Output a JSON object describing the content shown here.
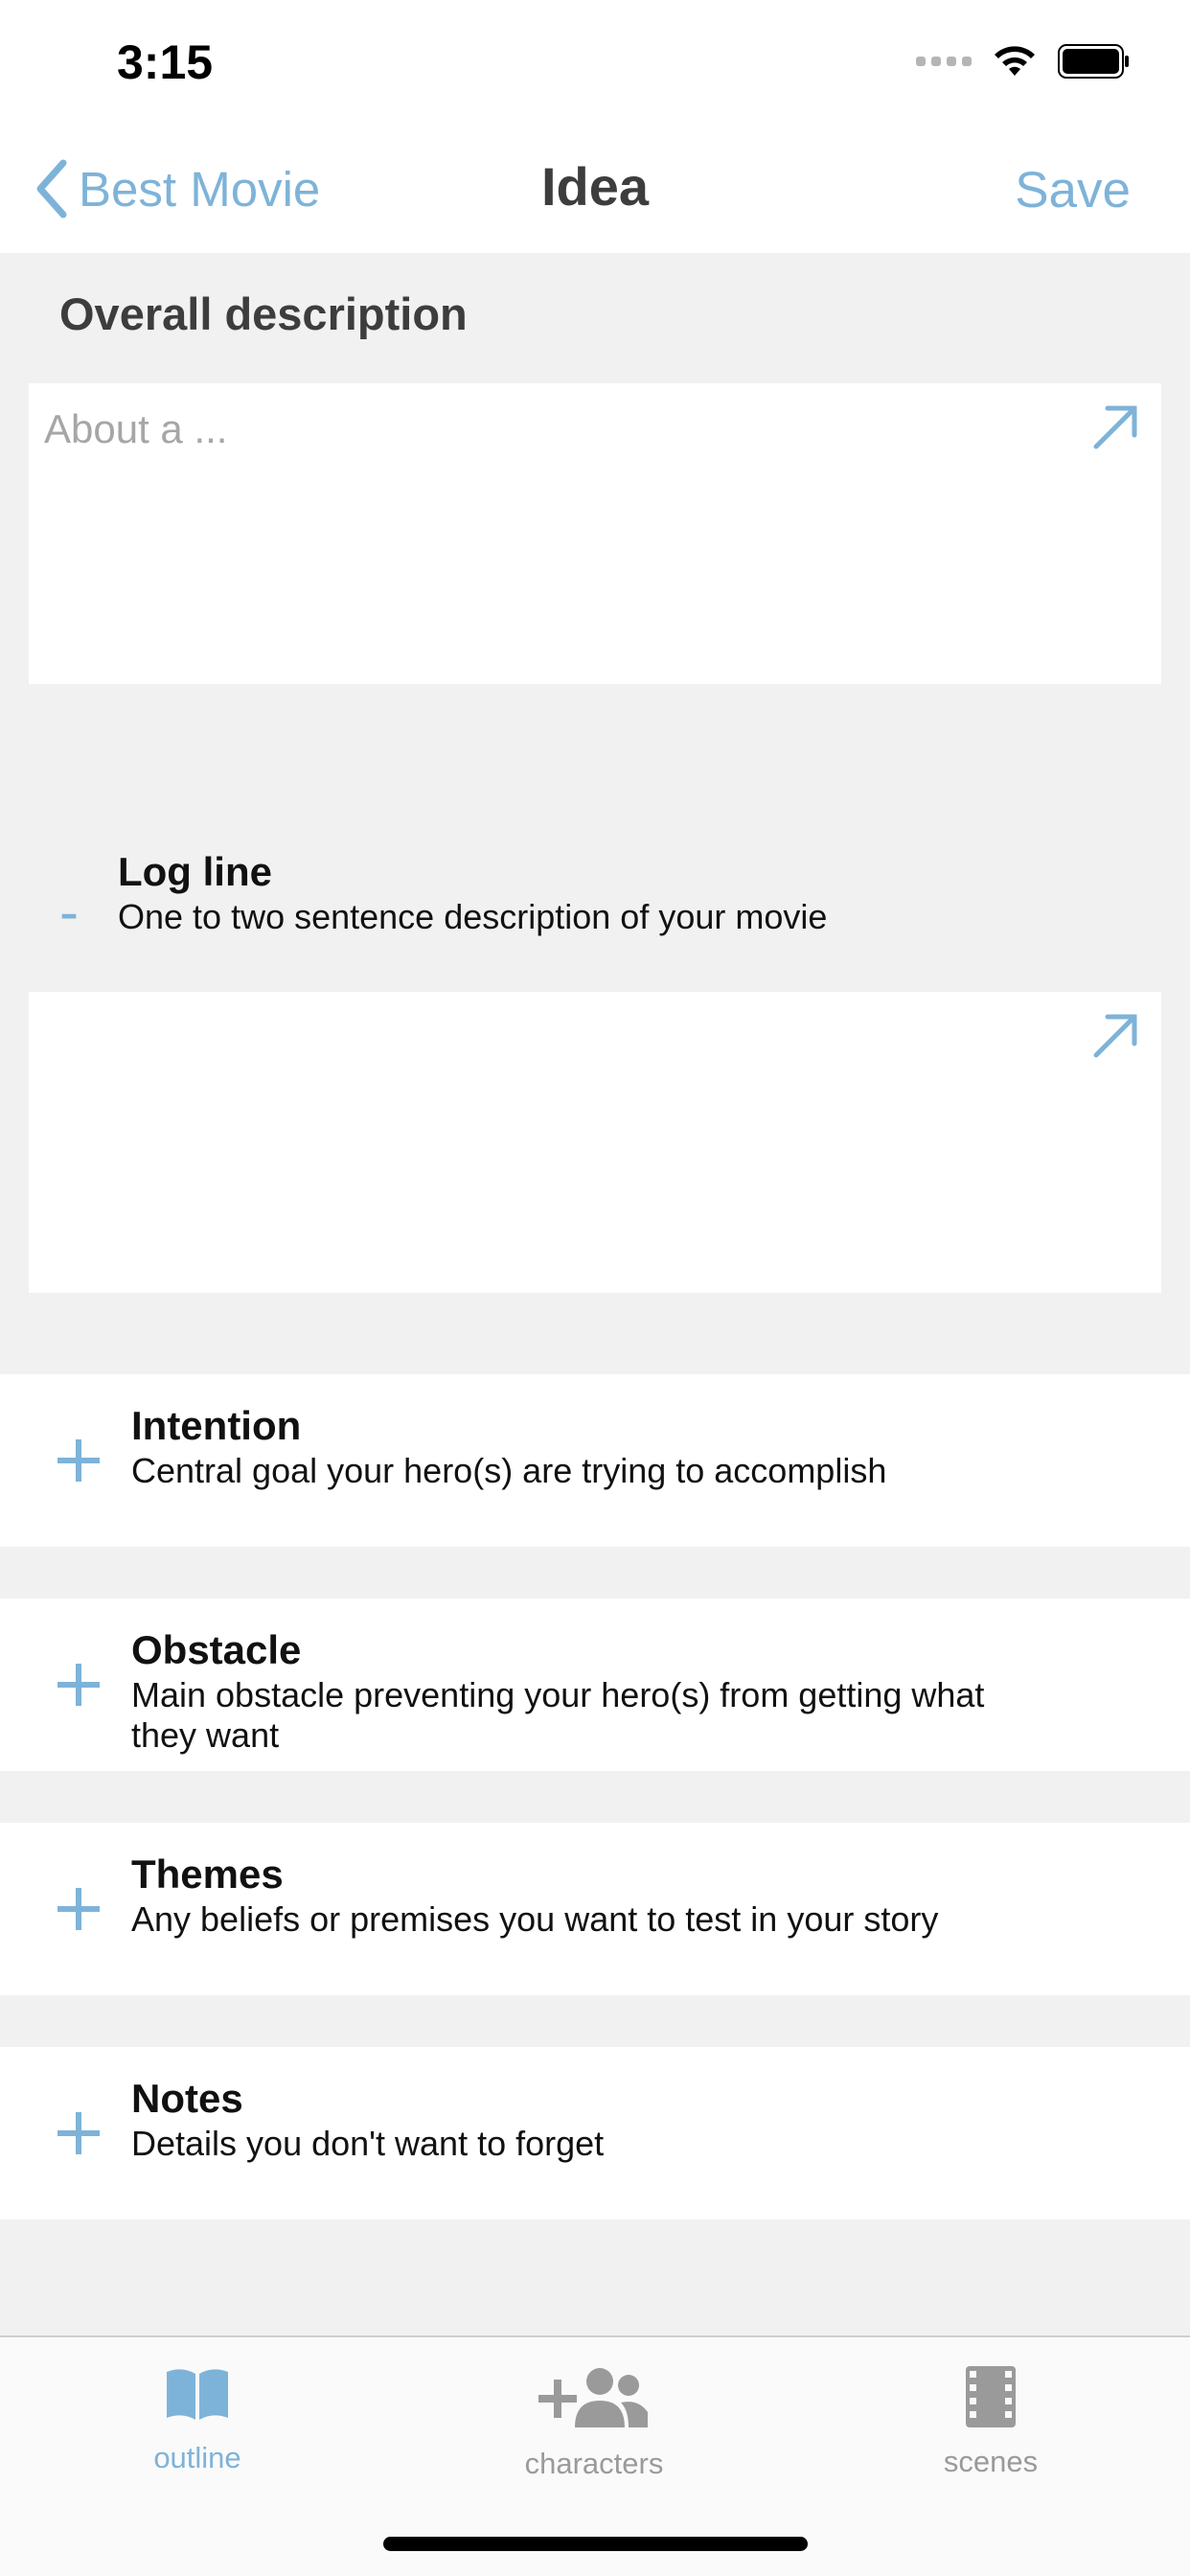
{
  "status_bar": {
    "time": "3:15"
  },
  "nav": {
    "back_label": "Best Movie",
    "title": "Idea",
    "save_label": "Save"
  },
  "overall": {
    "heading": "Overall description",
    "placeholder": "About a ..."
  },
  "log_line": {
    "title": "Log line",
    "description": "One to two sentence description of your movie",
    "toggle": "-"
  },
  "sections": [
    {
      "title": "Intention",
      "description": "Central goal your hero(s) are trying to accomplish"
    },
    {
      "title": "Obstacle",
      "description": "Main obstacle preventing your hero(s) from getting what they want"
    },
    {
      "title": "Themes",
      "description": "Any beliefs or premises you want to test in your story"
    },
    {
      "title": "Notes",
      "description": "Details you don't want to forget"
    }
  ],
  "tabs": [
    {
      "label": "outline",
      "icon": "book-icon",
      "active": true
    },
    {
      "label": "characters",
      "icon": "add-people-icon",
      "active": false
    },
    {
      "label": "scenes",
      "icon": "film-icon",
      "active": false
    }
  ],
  "colors": {
    "accent": "#7eb3d9",
    "background": "#f1f1f1",
    "inactive": "#9a9a9a"
  }
}
